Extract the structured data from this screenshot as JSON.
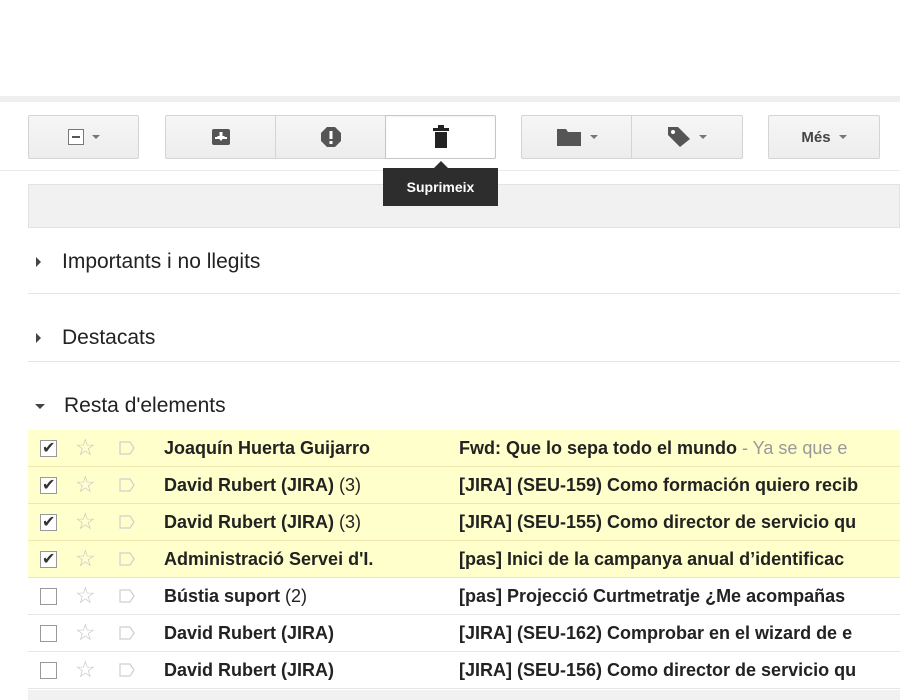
{
  "toolbar": {
    "more_label": "Més",
    "tooltip": "Suprimeix"
  },
  "sections": [
    {
      "label": "Importants i no llegits",
      "expanded": false
    },
    {
      "label": "Destacats",
      "expanded": false
    },
    {
      "label": "Resta d'elements",
      "expanded": true
    }
  ],
  "emails": [
    {
      "selected": true,
      "sender": "Joaquín Huerta Guijarro",
      "count": "",
      "subject": "Fwd: Que lo sepa todo el mundo",
      "snippet": " - Ya se que e"
    },
    {
      "selected": true,
      "sender": "David Rubert (JIRA)",
      "count": " (3)",
      "subject": "[JIRA] (SEU-159) Como formación quiero recib",
      "snippet": ""
    },
    {
      "selected": true,
      "sender": "David Rubert (JIRA)",
      "count": " (3)",
      "subject": "[JIRA] (SEU-155) Como director de servicio qu",
      "snippet": ""
    },
    {
      "selected": true,
      "sender": "Administració Servei d'I.",
      "count": "",
      "subject": "[pas] Inici de la campanya anual d’identificac",
      "snippet": ""
    },
    {
      "selected": false,
      "sender": "Bústia suport",
      "count": " (2)",
      "subject": "[pas] Projecció Curtmetratje ¿Me acompañas",
      "snippet": ""
    },
    {
      "selected": false,
      "sender": "David Rubert (JIRA)",
      "count": "",
      "subject": "[JIRA] (SEU-162) Comprobar en el wizard de e",
      "snippet": ""
    },
    {
      "selected": false,
      "sender": "David Rubert (JIRA)",
      "count": "",
      "subject": "[JIRA] (SEU-156) Como director de servicio qu",
      "snippet": ""
    }
  ]
}
